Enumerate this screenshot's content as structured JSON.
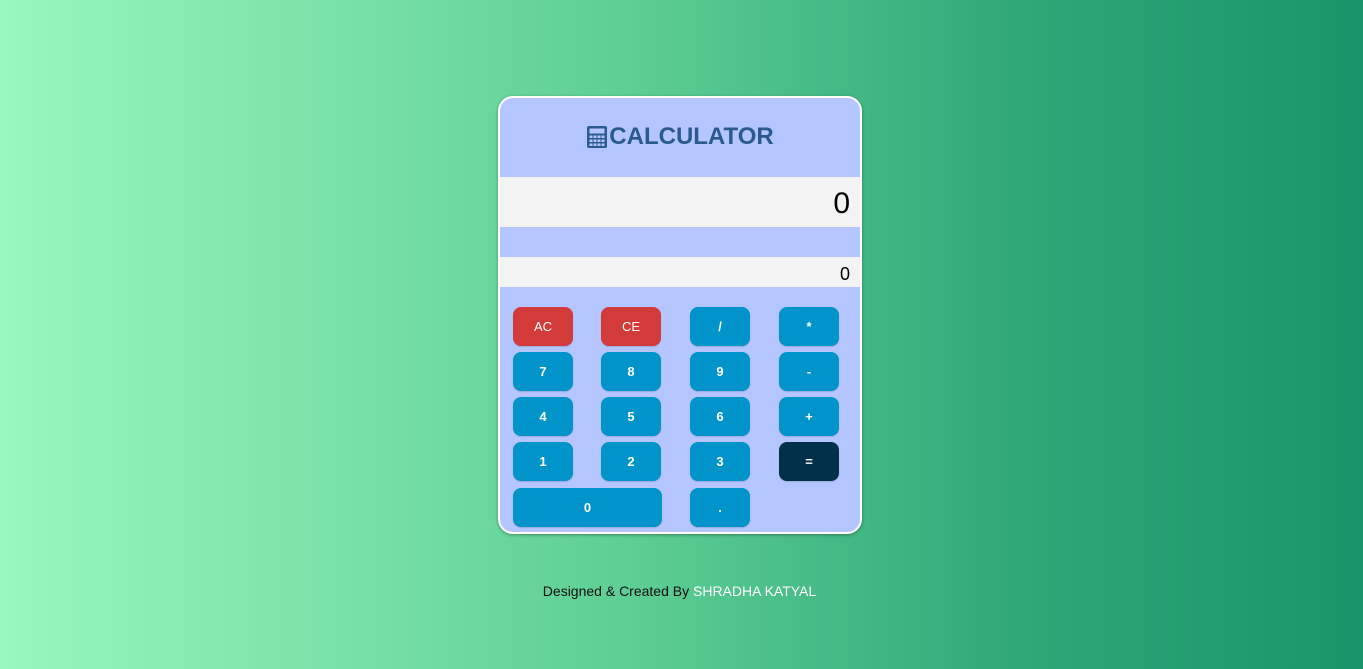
{
  "calculator": {
    "title": "CALCULATOR",
    "title_icon": "calculator-icon",
    "display_value": "0",
    "secondary_value": "0"
  },
  "keys": {
    "ac": "AC",
    "ce": "CE",
    "divide": "/",
    "multiply": "*",
    "seven": "7",
    "eight": "8",
    "nine": "9",
    "minus": "-",
    "four": "4",
    "five": "5",
    "six": "6",
    "plus": "+",
    "one": "1",
    "two": "2",
    "three": "3",
    "equals": "=",
    "zero": "0",
    "dot": "."
  },
  "footer": {
    "text": "Designed & Created By",
    "author": "SHRADHA KATYAL"
  },
  "colors": {
    "background_start": "#98f8bd",
    "background_end": "#18956a",
    "panel": "#b5c5ff",
    "key": "#0094cb",
    "clear_key": "#d23b3a",
    "equals_key": "#00304a",
    "title": "#2b5a91"
  }
}
